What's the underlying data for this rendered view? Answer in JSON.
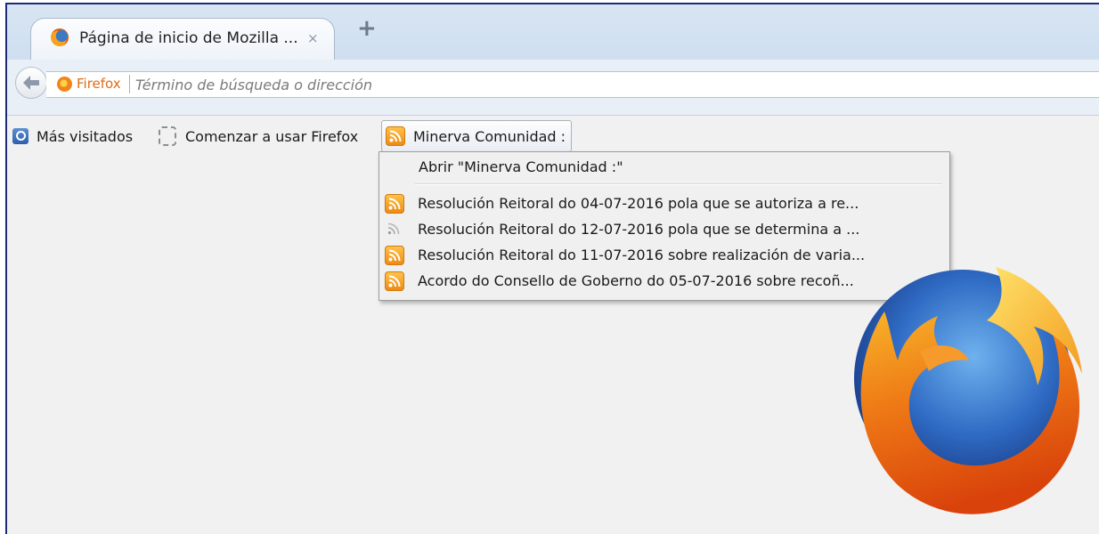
{
  "tab": {
    "title": "Página de inicio de Mozilla ...",
    "close_glyph": "×",
    "new_tab_glyph": "+"
  },
  "navbar": {
    "identity_label": "Firefox",
    "url_placeholder": "Término de búsqueda o dirección",
    "url_value": ""
  },
  "bookmarks": [
    {
      "label": "Más visitados",
      "icon": "most-visited-icon"
    },
    {
      "label": "Comenzar a usar Firefox",
      "icon": "dashed-bookmark-icon"
    },
    {
      "label": "Minerva Comunidad :",
      "icon": "rss-feed-icon"
    }
  ],
  "feed_menu": {
    "open_label": "Abrir \"Minerva Comunidad :\"",
    "items": [
      {
        "label": "Resolución Reitoral do 04-07-2016 pola que se autoriza a re...",
        "icon": "rss-icon",
        "visited": false
      },
      {
        "label": "Resolución Reitoral do 12-07-2016 pola que se determina a ...",
        "icon": "rss-icon-grey",
        "visited": true
      },
      {
        "label": "Resolución Reitoral do 11-07-2016 sobre realización de varia...",
        "icon": "rss-icon",
        "visited": false
      },
      {
        "label": "Acordo do Consello de Goberno do 05-07-2016 sobre recoñ...",
        "icon": "rss-icon",
        "visited": false
      }
    ]
  },
  "colors": {
    "window_border": "#1c2a78",
    "firefox_orange": "#e06c14",
    "rss_orange": "#f08a12",
    "content_bg": "#f1f1f1"
  }
}
